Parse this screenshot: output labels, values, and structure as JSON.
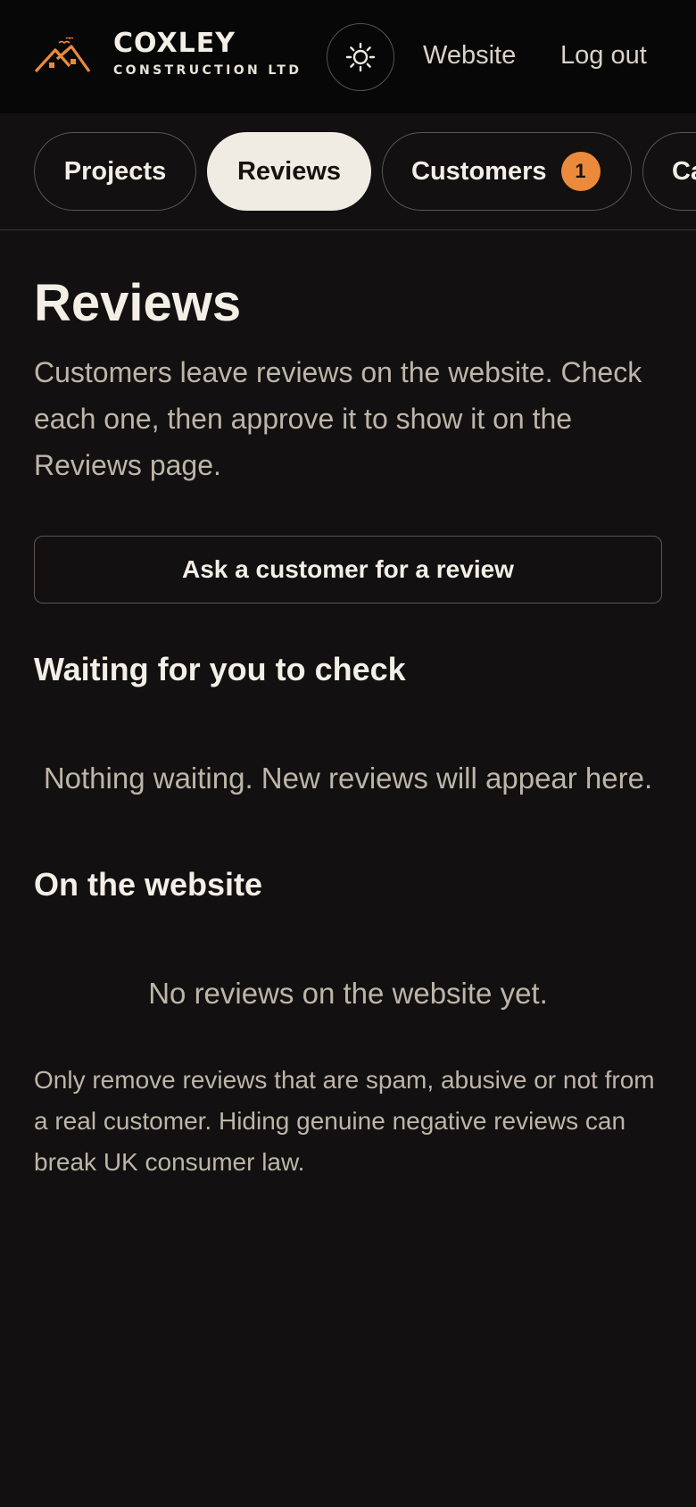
{
  "brand": {
    "name": "COXLEY",
    "subtitle": "CONSTRUCTION LTD",
    "logo_icon": "house-roofs-logo",
    "accent_color": "#ec8a3c"
  },
  "header": {
    "theme_toggle_icon": "sun-icon",
    "links": {
      "website": "Website",
      "logout": "Log out"
    }
  },
  "tabs": [
    {
      "label": "Projects",
      "active": false
    },
    {
      "label": "Reviews",
      "active": true
    },
    {
      "label": "Customers",
      "active": false,
      "badge": "1"
    },
    {
      "label": "Ca",
      "active": false
    }
  ],
  "main": {
    "title": "Reviews",
    "intro": "Customers leave reviews on the website. Check each one, then approve it to show it on the Reviews page.",
    "ask_button_label": "Ask a customer for a review",
    "sections": {
      "waiting": {
        "heading": "Waiting for you to check",
        "empty_message": "Nothing waiting. New reviews will appear here."
      },
      "website": {
        "heading": "On the website",
        "empty_message": "No reviews on the website yet."
      }
    },
    "legal_note": "Only remove reviews that are spam, abusive or not from a real customer. Hiding genuine negative reviews can break UK consumer law."
  }
}
